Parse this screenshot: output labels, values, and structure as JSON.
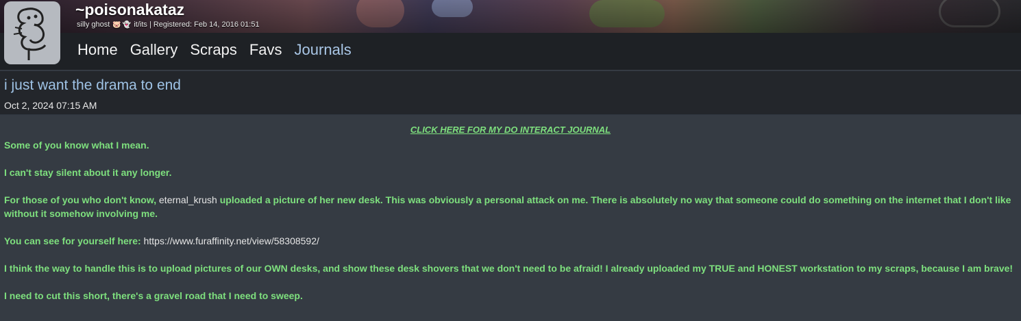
{
  "profile": {
    "username": "~poisonakataz",
    "tagline_prefix": "silly ghost",
    "tagline_emojis": [
      "pig-emoji",
      "ghost-emoji"
    ],
    "tagline_suffix": "it/its | Registered: Feb 14, 2016 01:51"
  },
  "nav": {
    "items": [
      "Home",
      "Gallery",
      "Scraps",
      "Favs",
      "Journals"
    ],
    "active": "Journals"
  },
  "journal": {
    "title": "i just want the drama to end",
    "date": "Oct 2, 2024 07:15 AM",
    "do_interact_link": "CLICK HERE FOR MY DO INTERACT JOURNAL",
    "p1": "Some of you know what I mean.",
    "p2": "I can't stay silent about it any longer.",
    "p3_before": "For those of you who don't know, ",
    "p3_user": "eternal_krush",
    "p3_after": " uploaded a picture of her new desk. This was obviously a personal attack on me. There is absolutely no way that someone could do something on the internet that I don't like without it somehow involving me.",
    "p4_before": "You can see for yourself here: ",
    "p4_link": "https://www.furaffinity.net/view/58308592/",
    "p5": "I think the way to handle this is to upload pictures of our OWN desks, and show these desk shovers that we don't need to be afraid! I already uploaded my TRUE and HONEST workstation to my scraps, because I am brave!",
    "p6": "I need to cut this short, there's a gravel road that I need to sweep."
  },
  "colors": {
    "body_text": "#7ee07e",
    "title": "#9fc3e6",
    "active_nav": "#a9c6e6"
  }
}
